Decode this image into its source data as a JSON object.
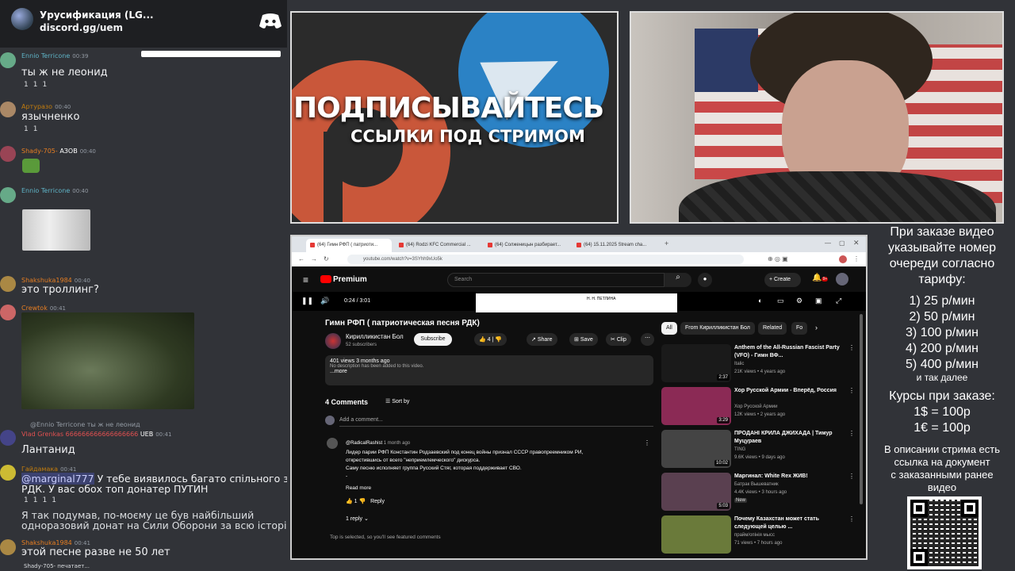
{
  "server": {
    "name": "Урусификация (LG...",
    "invite": "discord.gg/uem"
  },
  "chat": [
    {
      "user": "Ennio Terricone",
      "color": "#5fb4c7",
      "time": "00:39",
      "text": "ты ж не леонид",
      "reactions": [
        "1",
        "1",
        "1"
      ]
    },
    {
      "user": "Артуразо",
      "color": "#c27c0e",
      "time": "00:40",
      "text": "язычненко",
      "reactions": [
        "1",
        "1"
      ]
    },
    {
      "user": "Shady-705-",
      "color": "#e67e22",
      "tag": "АЗОВ",
      "time": "00:40",
      "text": ""
    },
    {
      "user": "Ennio Terricone",
      "color": "#5fb4c7",
      "time": "00:40",
      "text": ""
    },
    {
      "user": "Shakshuka1984",
      "color": "#e67e22",
      "time": "00:40",
      "text": "это троллинг?"
    },
    {
      "user": "Crewtok",
      "color": "#e67e22",
      "time": "00:41",
      "text": ""
    },
    {
      "reply_user": "@Ennio Terricone",
      "reply_text": "ты ж не леонид",
      "user": "Vlad Grenkas",
      "color": "#e05050",
      "spam": "666666666666666666",
      "tag": "UEB",
      "time": "00:41",
      "text": "Лантанид"
    },
    {
      "user": "Гайдамака",
      "color": "#c27c0e",
      "time": "00:41",
      "mention": "@marginal777",
      "text": "У тебе виявилось багато спільного з",
      "text2": "РДК. У вас обох топ донатер ПУТИН",
      "reactions": [
        "1",
        "1",
        "1",
        "1"
      ]
    },
    {
      "text": "Я так подумав, по-моєму це був найбільший",
      "text2": "одноразовий донат на Сили Оборони за всю історію"
    },
    {
      "user": "Shakshuka1984",
      "color": "#e67e22",
      "time": "00:41",
      "text": "этой песне разве не 50 лет"
    }
  ],
  "typing": "Shady-705- печатает...",
  "promo": {
    "line1": "ПОДПИСЫВАЙТЕСЬ",
    "line2": "ССЫЛКИ ПОД СТРИМОМ"
  },
  "info": {
    "intro": [
      "При заказе видео",
      "указывайте номер",
      "очереди согласно",
      "тарифу:"
    ],
    "tariffs": [
      "1) 25 р/мин",
      "2) 50 р/мин",
      "3) 100 р/мин",
      "4) 200 р/мин",
      "5) 400 р/мин"
    ],
    "etc": "и так далее",
    "rates_title": "Курсы при заказе:",
    "rates": [
      "1$ = 100р",
      "1€ = 100р"
    ],
    "outro": [
      "В описании стрима есть",
      "ссылка на документ",
      "с заказанными ранее",
      "видео"
    ]
  },
  "browser": {
    "tabs": [
      "(64) Гимн РФП ( патриоти...",
      "(64) Rodzi KFC Commercial ...",
      "(64) Солженицын разбирает...",
      "(64) 15.11.2025 Stream cha..."
    ],
    "url": "youtube.com/watch?v=3SYhh9xUo5k"
  },
  "youtube": {
    "brand": "Premium",
    "search_placeholder": "Search",
    "create": "Create",
    "notif_count": "9+",
    "time": "0:24 / 3:01",
    "thumb_text": "Н. Н. ПЕТЛИНА",
    "title": "Гимн РФП ( патриотическая песня РДК)",
    "channel": "Кирилликистан Бол",
    "subs": "52 subscribers",
    "subscribe": "Subscribe",
    "likes": "4",
    "share": "Share",
    "save": "Save",
    "clip": "Clip",
    "views": "401 views  3 months ago",
    "desc": "No description has been added to this video.",
    "more": "...more",
    "comments_count": "4 Comments",
    "sort": "Sort by",
    "add_comment": "Add a comment...",
    "comment_user": "@RadicalRashist",
    "comment_time": "1 month ago",
    "comment_lines": [
      "Лидер парии РФП Константин Родзаевский под конец войны признал СССР правопреемником РИ,",
      "открестившись от всего \"неприемлемческого\" дискурса.",
      "Саму песню исполняет группа Русский Стяг, которая поддерживает СВО.",
      "-"
    ],
    "read_more": "Read more",
    "comment_likes": "1",
    "reply": "Reply",
    "replies": "1 reply",
    "top_note": "Top is selected, so you'll see featured comments",
    "chips": [
      "All",
      "From Кирилликистан Бол",
      "Related",
      "Fo"
    ],
    "recs": [
      {
        "title": "Anthem of the All-Russian Fascist Party (VFO) - Гимн ВФ...",
        "channel": "Italic",
        "meta": "21K views • 4 years ago",
        "dur": "2:37",
        "color": "#1a1a1a"
      },
      {
        "title": "Хор Русской Армии - Вперёд, Россия",
        "channel": "Хор Русской Армии",
        "meta": "12K views • 2 years ago",
        "dur": "3:29",
        "color": "#8b2a55"
      },
      {
        "title": "ПРОДАНІ КРИЛА ДЖИХАДА | Тимур Муцураев",
        "channel": "TING",
        "meta": "9.6K views • 9 days ago",
        "dur": "10:02",
        "color": "#444"
      },
      {
        "title": "Маргинал: White Rex ЖИВ!",
        "channel": "Батрак Вышеватник",
        "meta": "4.4K views • 3 hours ago",
        "badge": "New",
        "dur": "5:03",
        "color": "#5a4050"
      },
      {
        "title": "Почему Казахстан может стать следующей целью ...",
        "channel": "прайм/опінія мысс",
        "meta": "71 views • 7 hours ago",
        "dur": "",
        "color": "#6a7a3a"
      }
    ]
  }
}
